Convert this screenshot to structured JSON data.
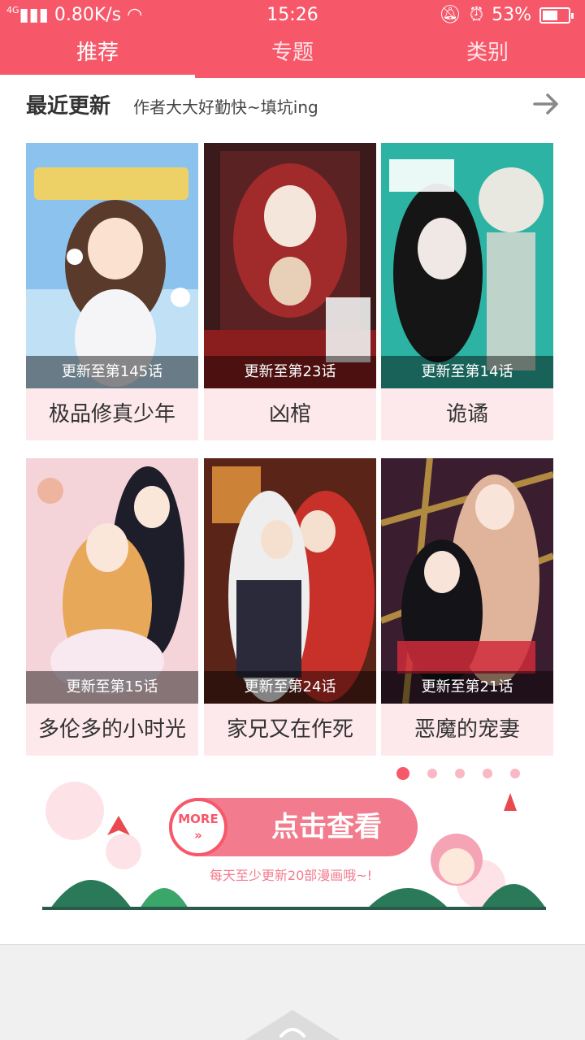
{
  "status_bar": {
    "network": "4G",
    "speed": "0.80K/s",
    "time": "15:26",
    "battery": "53%",
    "battery_level": 0.53
  },
  "tabs": [
    {
      "label": "推荐",
      "active": true
    },
    {
      "label": "专题",
      "active": false
    },
    {
      "label": "类别",
      "active": false
    }
  ],
  "section": {
    "title": "最近更新",
    "subtitle": "作者大大好勤快~填坑ing"
  },
  "comics": [
    {
      "title": "极品修真少年",
      "episode": "更新至第145话",
      "cover_color": "#7fb5e8"
    },
    {
      "title": "凶棺",
      "episode": "更新至第23话",
      "cover_color": "#7a2a2a"
    },
    {
      "title": "诡谲",
      "episode": "更新至第14话",
      "cover_color": "#2aa79b"
    },
    {
      "title": "多伦多的小时光",
      "episode": "更新至第15话",
      "cover_color": "#e8b5c0"
    },
    {
      "title": "家兄又在作死",
      "episode": "更新至第24话",
      "cover_color": "#a8322d"
    },
    {
      "title": "恶魔的宠妻",
      "episode": "更新至第21话",
      "cover_color": "#4a2a3a"
    }
  ],
  "banner": {
    "more_label": "MORE",
    "button_label": "点击查看",
    "caption": "每天至少更新20部漫画哦~!",
    "dots": 5,
    "active_dot": 0
  },
  "colors": {
    "accent": "#f6586a",
    "card_title_bg": "#fde8ec"
  }
}
